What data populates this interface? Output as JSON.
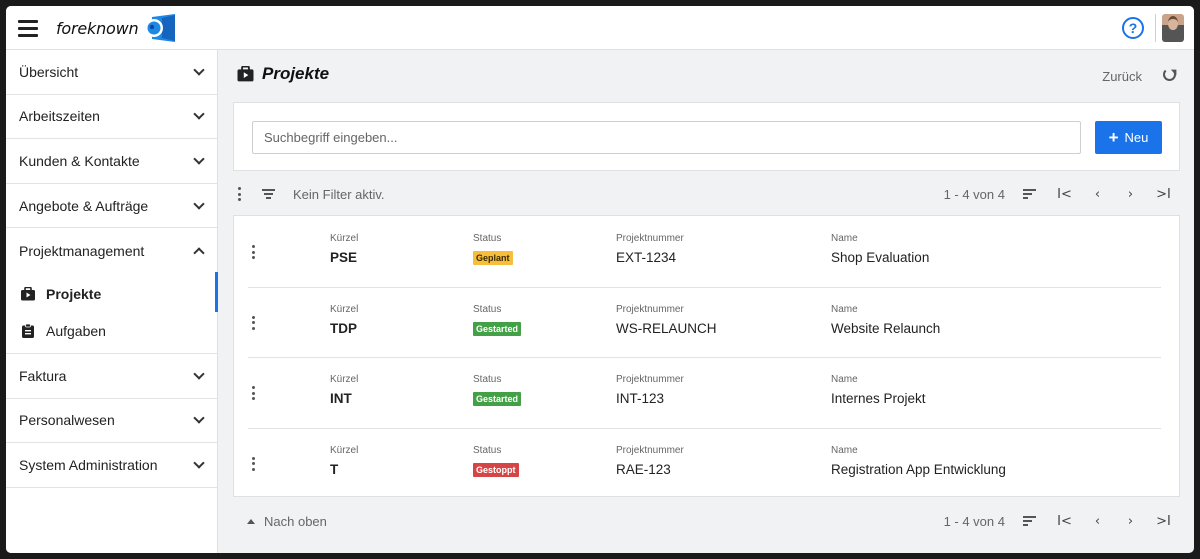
{
  "header": {
    "logo_text": "foreknown",
    "help_icon_glyph": "?"
  },
  "sidebar": {
    "sections_top": [
      {
        "label": "Übersicht"
      },
      {
        "label": "Arbeitszeiten"
      },
      {
        "label": "Kunden & Kontakte"
      },
      {
        "label": "Angebote & Aufträge"
      }
    ],
    "expanded": {
      "label": "Projektmanagement",
      "items": [
        {
          "label": "Projekte",
          "icon": "briefcase-icon",
          "active": true
        },
        {
          "label": "Aufgaben",
          "icon": "clipboard-icon",
          "active": false
        }
      ]
    },
    "sections_bottom": [
      {
        "label": "Faktura"
      },
      {
        "label": "Personalwesen"
      },
      {
        "label": "System Administration"
      }
    ]
  },
  "page": {
    "title": "Projekte",
    "back_label": "Zurück"
  },
  "search": {
    "placeholder": "Suchbegriff eingeben...",
    "value": "",
    "new_button_label": "Neu",
    "new_button_glyph": "+"
  },
  "toolbar": {
    "filter_text": "Kein Filter aktiv.",
    "range_text": "1 - 4 von 4",
    "pager": {
      "first": "I<",
      "prev": "‹",
      "next": "›",
      "last": ">I"
    }
  },
  "columns": {
    "kuerzel": "Kürzel",
    "status": "Status",
    "projektnummer": "Projektnummer",
    "name": "Name"
  },
  "projects": [
    {
      "kuerzel": "PSE",
      "status": "Geplant",
      "status_color": "#f6be3b",
      "status_text_color": "#3a2a00",
      "projektnummer": "EXT-1234",
      "name": "Shop Evaluation"
    },
    {
      "kuerzel": "TDP",
      "status": "Gestarted",
      "status_color": "#43a047",
      "status_text_color": "#ffffff",
      "projektnummer": "WS-RELAUNCH",
      "name": "Website Relaunch"
    },
    {
      "kuerzel": "INT",
      "status": "Gestarted",
      "status_color": "#43a047",
      "status_text_color": "#ffffff",
      "projektnummer": "INT-123",
      "name": "Internes Projekt"
    },
    {
      "kuerzel": "T",
      "status": "Gestoppt",
      "status_color": "#d64545",
      "status_text_color": "#ffffff",
      "projektnummer": "RAE-123",
      "name": "Registration App Entwicklung"
    }
  ],
  "footer": {
    "to_top_label": "Nach oben",
    "range_text": "1 - 4 von 4"
  },
  "colors": {
    "accent": "#1a73e8"
  }
}
